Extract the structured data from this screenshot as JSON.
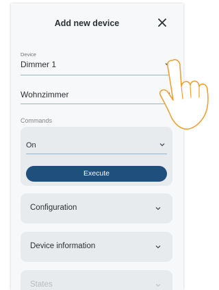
{
  "dialog": {
    "title": "Add new device",
    "close_icon": "close-icon"
  },
  "device_field": {
    "caption": "Device",
    "value": "Dimmer 1"
  },
  "room_field": {
    "value": "Wohnzimmer"
  },
  "commands": {
    "section_label": "Commands",
    "selected": "On",
    "execute_label": "Execute"
  },
  "sections": [
    {
      "label": "Configuration"
    },
    {
      "label": "Device information"
    },
    {
      "label": "States"
    }
  ],
  "colors": {
    "accent": "#1e4f7d",
    "panel": "#e8ebed",
    "hand_outline": "#f0a030"
  }
}
